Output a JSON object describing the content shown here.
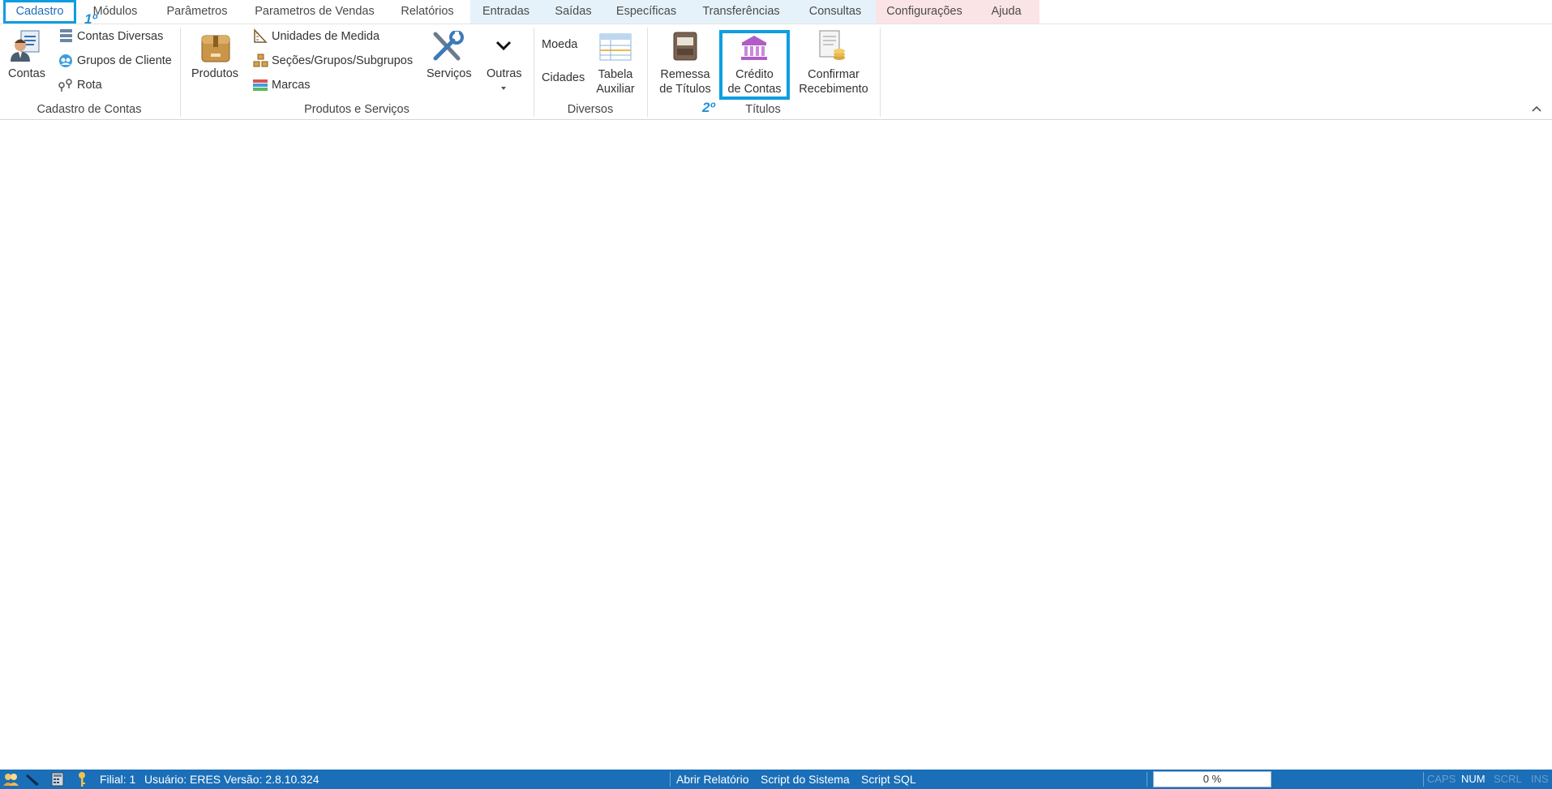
{
  "tabs": [
    {
      "label": "Cadastro"
    },
    {
      "label": "Módulos"
    },
    {
      "label": "Parâmetros"
    },
    {
      "label": "Parametros de Vendas"
    },
    {
      "label": "Relatórios"
    },
    {
      "label": "Entradas"
    },
    {
      "label": "Saídas"
    },
    {
      "label": "Específicas"
    },
    {
      "label": "Transferências"
    },
    {
      "label": "Consultas"
    },
    {
      "label": "Configurações"
    },
    {
      "label": "Ajuda"
    }
  ],
  "annotations": {
    "first": "1º",
    "second": "2º"
  },
  "ribbon": {
    "cadastro_contas": {
      "title": "Cadastro de Contas",
      "contas": "Contas",
      "contas_diversas": "Contas Diversas",
      "grupos_cliente": "Grupos de Cliente",
      "rota": "Rota"
    },
    "produtos_servicos": {
      "title": "Produtos e Serviços",
      "produtos": "Produtos",
      "unidades": "Unidades de Medida",
      "secoes": "Seções/Grupos/Subgrupos",
      "marcas": "Marcas",
      "servicos": "Serviços",
      "outras": "Outras"
    },
    "diversos": {
      "title": "Diversos",
      "moeda": "Moeda",
      "cidades": "Cidades",
      "tabela_l1": "Tabela",
      "tabela_l2": "Auxiliar"
    },
    "titulos": {
      "title": "Títulos",
      "remessa_l1": "Remessa",
      "remessa_l2": "de Títulos",
      "credito_l1": "Crédito",
      "credito_l2": "de Contas",
      "confirmar_l1": "Confirmar",
      "confirmar_l2": "Recebimento"
    }
  },
  "statusbar": {
    "filial": "Filial: 1",
    "usuario": "Usuário: ERES",
    "versao": "Versão: 2.8.10.324",
    "abrir_relatorio": "Abrir Relatório",
    "script_sistema": "Script do Sistema",
    "script_sql": "Script SQL",
    "progress": "0 %",
    "progress_value": 0,
    "caps": "CAPS",
    "num": "NUM",
    "scrl": "SCRL",
    "ins": "INS"
  },
  "colors": {
    "accent": "#0e9ee0",
    "statusbar": "#1a6fb8"
  }
}
